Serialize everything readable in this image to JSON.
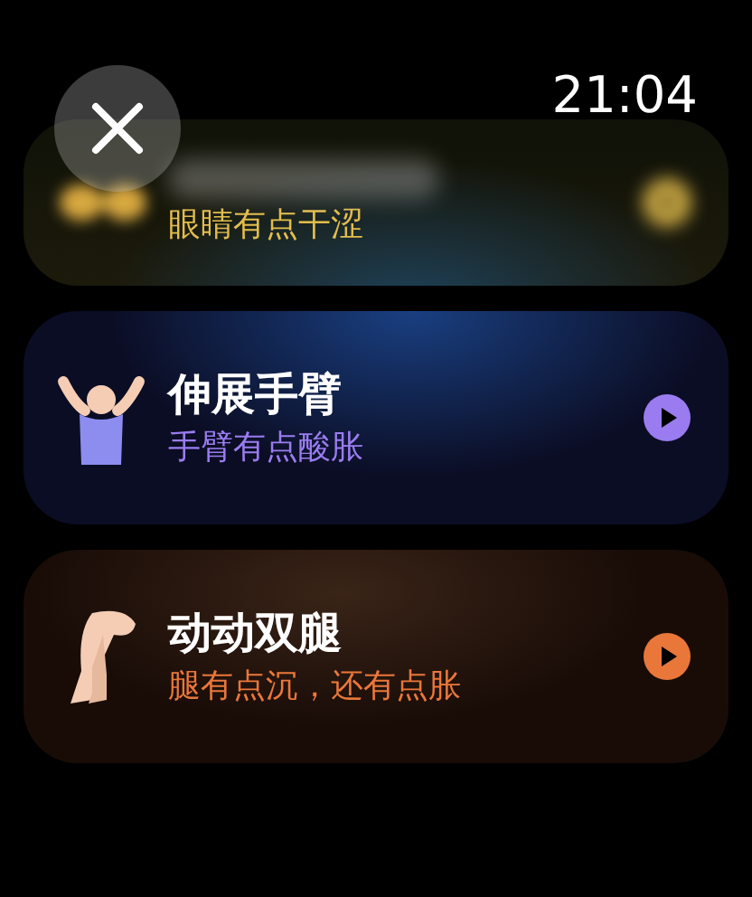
{
  "time": "21:04",
  "cards": [
    {
      "kind": "eyes",
      "subtitle": "眼睛有点干涩",
      "color": "#e3bd4c"
    },
    {
      "kind": "arms",
      "title": "伸展手臂",
      "subtitle": "手臂有点酸胀",
      "color": "#9a7cf0"
    },
    {
      "kind": "legs",
      "title": "动动双腿",
      "subtitle": "腿有点沉，还有点胀",
      "color": "#ea773a"
    }
  ]
}
